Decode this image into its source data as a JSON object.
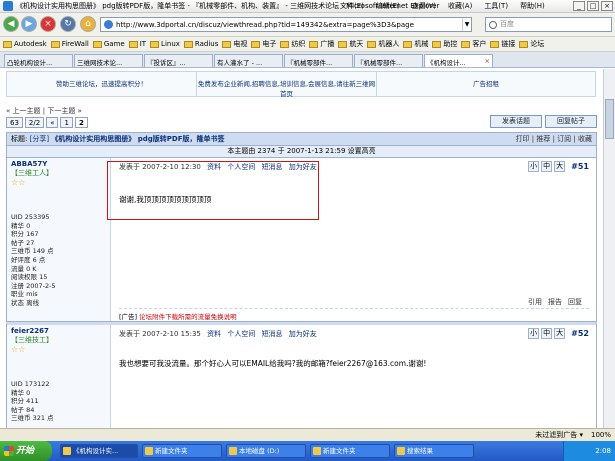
{
  "window": {
    "title": "《机构设计实用构思图册》 pdg版转PDF版，隆单书签 - 『机械零部件、机构、装置』 - 三维网技术论坛 - Microsoft Internet Explorer"
  },
  "menu": {
    "items": [
      "文件(E)",
      "编辑(E)",
      "查看(V)",
      "收藏(A)",
      "工具(T)",
      "帮助(H)"
    ]
  },
  "address": {
    "url": "http://www.3dportal.cn/discuz/viewthread.php?tid=149342&extra=page%3D3&page"
  },
  "search": {
    "placeholder": "百度"
  },
  "bookmarks": [
    "Autodesk",
    "FireWall",
    "Game",
    "IT",
    "Linux",
    "Radius",
    "电视",
    "电子",
    "纺织",
    "广播",
    "航天",
    "机器人",
    "机械",
    "助控",
    "客户",
    "链接",
    "论坛"
  ],
  "tabs": [
    "凸轮机构设计...",
    "三维网技术论...",
    "『投诉区』...",
    "有人灌水了 - ...",
    "『机械零部件...",
    "『机械零部件...",
    "《机构设计..."
  ],
  "ads": {
    "left": "赞助三维论坛，迅速提高积分！",
    "center": "免费发布企业新闻,招聘信息,培训信息,会展信息,请往新三维网首页",
    "right": "广告招租"
  },
  "topics_nav": "« 上一主题 | 下一主题 »",
  "pager": [
    "63",
    "2/2",
    "«",
    "1",
    "2"
  ],
  "buttons": {
    "new_topic": "发表话题",
    "reply": "回复帖子"
  },
  "thread": {
    "label": "标题:",
    "tag": "[分享]",
    "title": "《机构设计实用构思图册》 pdg版转PDF版，隆单书签",
    "tools": "打印 | 推荐 | 订阅 | 收藏",
    "views_line": "本主题由 2374 于 2007-1-13 21:59 设置高亮"
  },
  "posts": [
    {
      "username": "ABBA57Y",
      "level": "【三维工人】",
      "stars": "☆☆",
      "stats": [
        "UID 253395",
        "精华 0",
        "积分 167",
        "帖子 27",
        "三维币 149 点",
        "好评度 6 点",
        "流量 0 K",
        "阅读权限 15",
        "注册 2007-2-5",
        "职业 mis",
        "状态 离线"
      ],
      "meta": "发表于 2007-2-10 12:30",
      "meta_links": [
        "资料",
        "个人空间",
        "短消息",
        "加为好友"
      ],
      "controls": [
        "小",
        "中",
        "大"
      ],
      "number": "#51",
      "body": "谢谢,我顶顶顶顶顶顶顶顶顶",
      "bottom_links": [
        "引用",
        "报告",
        "回复"
      ],
      "ad_tag": "[广告]",
      "ad_text": "论坛附件下载所需的流量免换说明"
    },
    {
      "username": "feier2267",
      "level": "【三维技工】",
      "stars": "☆☆",
      "stats": [
        "UID 173122",
        "精华 0",
        "积分 411",
        "帖子 84",
        "三维币 321 点"
      ],
      "meta": "发表于 2007-2-10 15:35",
      "meta_links": [
        "资料",
        "个人空间",
        "短消息",
        "加为好友"
      ],
      "controls": [
        "小",
        "中",
        "大"
      ],
      "number": "#52",
      "body": "我也想要可我没流量。那个好心人可以EMAIL给我吗?我的邮箱?feier2267@163.com.谢谢!"
    }
  ],
  "statusbar": {
    "left": "",
    "right": [
      "未过滤到广告 ▾",
      "100%"
    ]
  },
  "taskbar": {
    "start": "开始",
    "tasks": [
      "《机构设计实...",
      "新建文件夹",
      "本地磁盘 (D:)",
      "新建文件夹",
      "搜索结果"
    ],
    "time": "2:08"
  }
}
